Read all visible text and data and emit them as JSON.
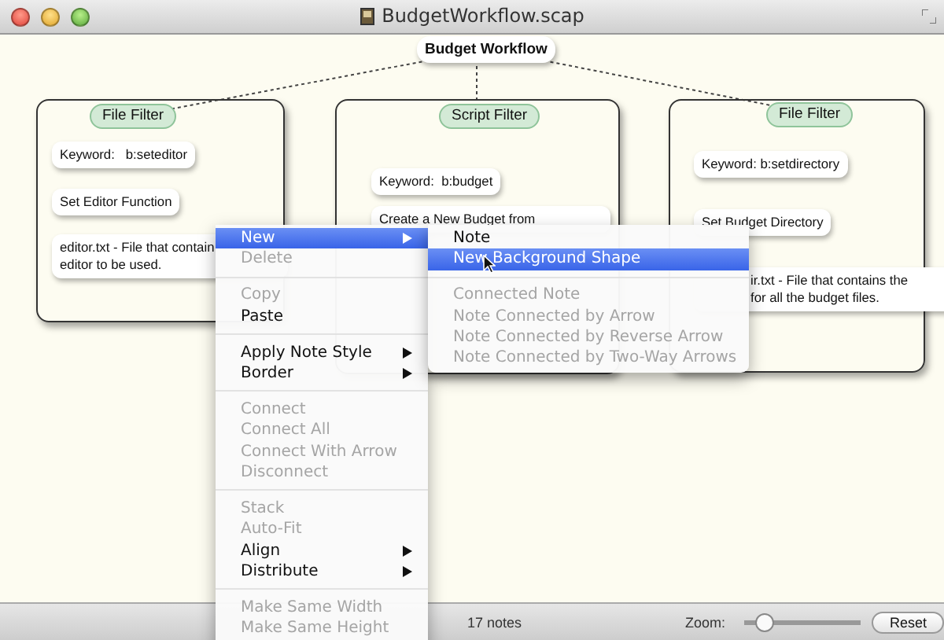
{
  "window": {
    "title": "BudgetWorkflow.scap"
  },
  "canvas": {
    "root": {
      "text": "Budget Workflow"
    },
    "groups": [
      {
        "header": "File Filter",
        "notes": [
          "Keyword:   b:seteditor",
          "Set Editor Function",
          "editor.txt - File that contain\neditor to be used."
        ]
      },
      {
        "header": "Script Filter",
        "notes": [
          "Keyword:  b:budget",
          "Create a New Budget from"
        ]
      },
      {
        "header": "File Filter",
        "notes": [
          "Keyword: b:setdirectory",
          "Set Budget Directory",
          "ir.txt - File that contains the\nfor all the budget files."
        ]
      }
    ]
  },
  "context_menu": {
    "sections": [
      [
        {
          "label": "New",
          "disabled": false,
          "selected": true,
          "submenu": true
        },
        {
          "label": "Delete",
          "disabled": true,
          "selected": false,
          "submenu": false
        }
      ],
      [
        {
          "label": "Copy",
          "disabled": true,
          "selected": false,
          "submenu": false
        },
        {
          "label": "Paste",
          "disabled": false,
          "selected": false,
          "submenu": false
        }
      ],
      [
        {
          "label": "Apply Note Style",
          "disabled": false,
          "selected": false,
          "submenu": true
        },
        {
          "label": "Border",
          "disabled": false,
          "selected": false,
          "submenu": true
        }
      ],
      [
        {
          "label": "Connect",
          "disabled": true,
          "selected": false,
          "submenu": false
        },
        {
          "label": "Connect All",
          "disabled": true,
          "selected": false,
          "submenu": false
        },
        {
          "label": "Connect With Arrow",
          "disabled": true,
          "selected": false,
          "submenu": false
        },
        {
          "label": "Disconnect",
          "disabled": true,
          "selected": false,
          "submenu": false
        }
      ],
      [
        {
          "label": "Stack",
          "disabled": true,
          "selected": false,
          "submenu": false
        },
        {
          "label": "Auto-Fit",
          "disabled": true,
          "selected": false,
          "submenu": false
        },
        {
          "label": "Align",
          "disabled": false,
          "selected": false,
          "submenu": true
        },
        {
          "label": "Distribute",
          "disabled": false,
          "selected": false,
          "submenu": true
        }
      ],
      [
        {
          "label": "Make Same Width",
          "disabled": true,
          "selected": false,
          "submenu": false
        },
        {
          "label": "Make Same Height",
          "disabled": true,
          "selected": false,
          "submenu": false
        }
      ]
    ]
  },
  "submenu": {
    "sections": [
      [
        {
          "label": "Note",
          "disabled": false,
          "selected": false
        },
        {
          "label": "New Background Shape",
          "disabled": false,
          "selected": true
        }
      ],
      [
        {
          "label": "Connected Note",
          "disabled": true,
          "selected": false
        },
        {
          "label": "Note Connected by Arrow",
          "disabled": true,
          "selected": false
        },
        {
          "label": "Note Connected by Reverse Arrow",
          "disabled": true,
          "selected": false
        },
        {
          "label": "Note Connected by Two-Way Arrows",
          "disabled": true,
          "selected": false
        }
      ]
    ]
  },
  "status_bar": {
    "count": "17 notes",
    "zoom_label": "Zoom:",
    "zoom": {
      "level": 0.17
    },
    "reset_button": "Reset"
  }
}
